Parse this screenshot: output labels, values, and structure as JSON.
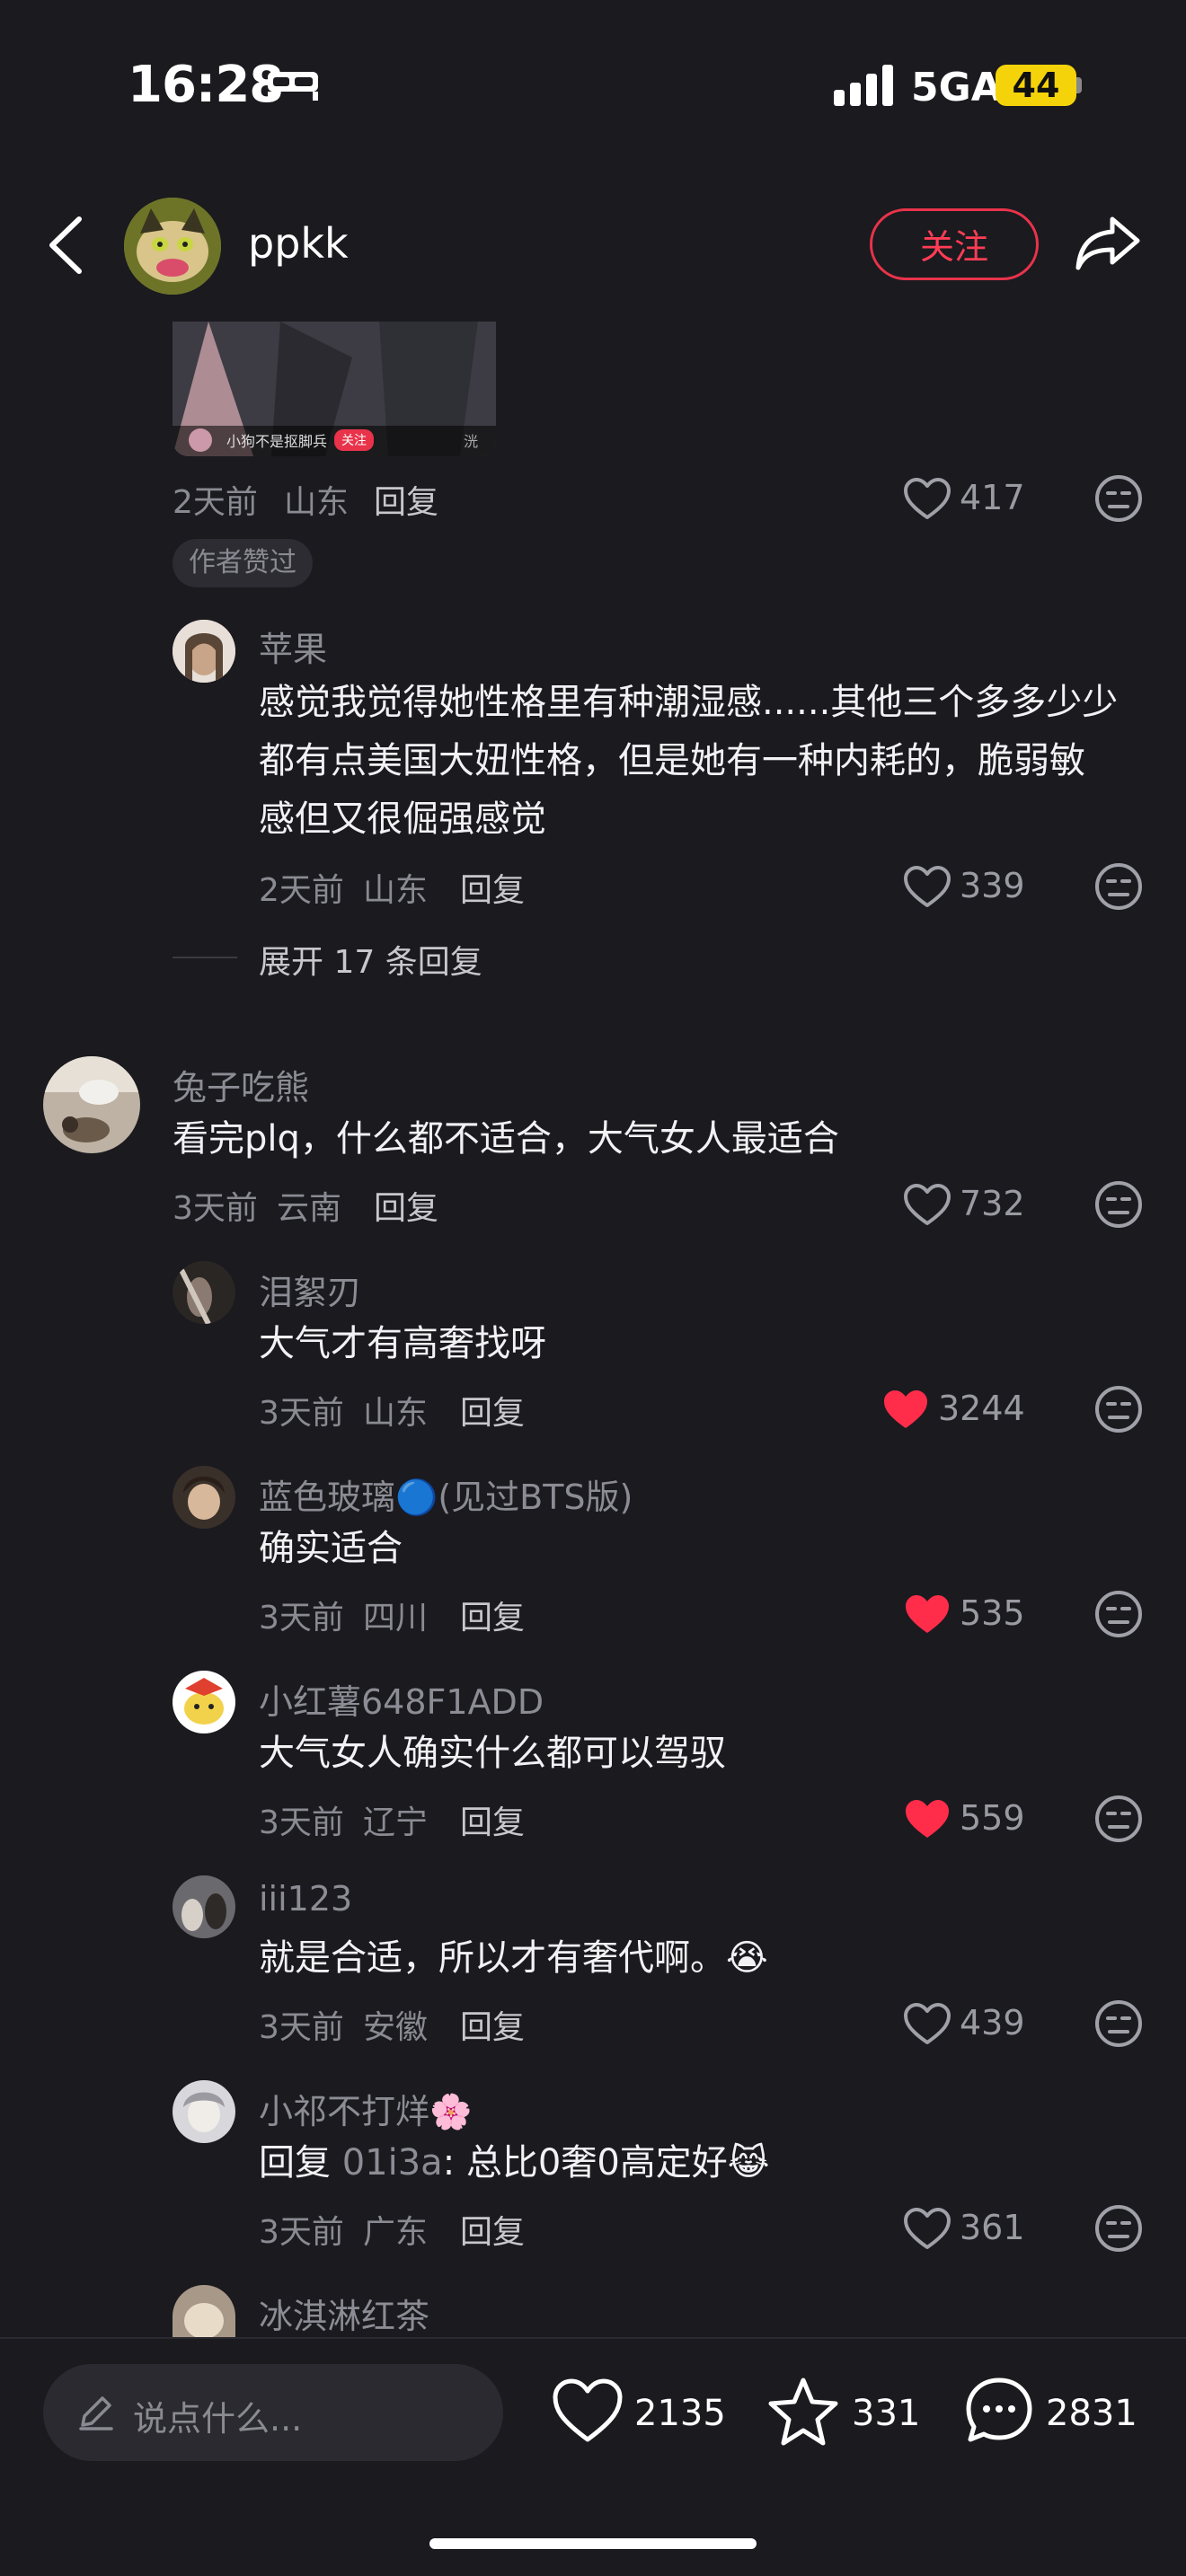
{
  "status": {
    "time": "16:28",
    "network": "5GA",
    "battery": "44"
  },
  "header": {
    "username": "ppkk",
    "follow_label": "关注"
  },
  "thumbnail": {
    "author": "小狗不是抠脚兵",
    "follow": "关注",
    "right": "洸"
  },
  "top_comment": {
    "time": "2天前",
    "location": "山东",
    "reply_label": "回复",
    "likes": "417",
    "author_liked": "作者赞过"
  },
  "reply_apple": {
    "user": "苹果",
    "lines": [
      "感觉我觉得她性格里有种潮湿感......其他三个多多少少",
      "都有点美国大妞性格，但是她有一种内耗的，脆弱敏",
      "感但又很倔强感觉"
    ],
    "time": "2天前",
    "location": "山东",
    "reply_label": "回复",
    "likes": "339"
  },
  "expand": "展开 17 条回复",
  "comment_main": {
    "user": "兔子吃熊",
    "text": "看完plq，什么都不适合，大气女人最适合",
    "time": "3天前",
    "location": "云南",
    "reply_label": "回复",
    "likes": "732"
  },
  "replies": [
    {
      "user": "泪絮刃",
      "text": "大气才有高奢找呀",
      "time": "3天前",
      "location": "山东",
      "reply_label": "回复",
      "likes": "3244",
      "liked": true
    },
    {
      "user": "蓝色玻璃🔵(见过BTS版)",
      "text": "确实适合",
      "time": "3天前",
      "location": "四川",
      "reply_label": "回复",
      "likes": "535",
      "liked": true
    },
    {
      "user": "小红薯648F1ADD",
      "text": "大气女人确实什么都可以驾驭",
      "time": "3天前",
      "location": "辽宁",
      "reply_label": "回复",
      "likes": "559",
      "liked": true
    },
    {
      "user": "iii123",
      "text": "就是合适，所以才有奢代啊。😭",
      "time": "3天前",
      "location": "安徽",
      "reply_label": "回复",
      "likes": "439",
      "liked": false
    },
    {
      "user": "小祁不打烊🌸",
      "text_prefix": "回复 ",
      "text_mention": "01i3a",
      "text_rest": ": 总比0奢0高定好😹",
      "time": "3天前",
      "location": "广东",
      "reply_label": "回复",
      "likes": "361",
      "liked": false
    },
    {
      "user": "冰淇淋红茶"
    }
  ],
  "bottom_bar": {
    "placeholder": "说点什么...",
    "likes": "2135",
    "favorites": "331",
    "comments": "2831"
  },
  "colors": {
    "background": "#1a1a1f",
    "accent_red": "#ff3d55",
    "liked_heart": "#ff2d4a"
  }
}
